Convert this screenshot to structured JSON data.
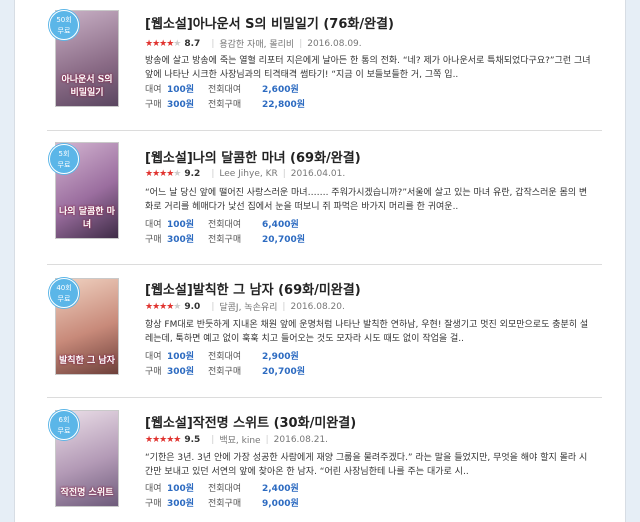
{
  "labels": {
    "rent": "대여",
    "buy": "구매",
    "rent_all": "전회대여",
    "buy_all": "전회구매"
  },
  "items": [
    {
      "badge_count": "50회",
      "badge_free": "무료",
      "cover_text": "아나운서 S의 비밀일기",
      "title": "[웹소설]아나운서 S의 비밀일기 (76화/완결)",
      "stars_filled": 4,
      "rating": "8.7",
      "author": "용감한 자매, 몰리비",
      "date": "2016.08.09.",
      "desc": "방송에 살고 방송에 죽는 열혈 리포터 지은에게 날아든 한 통의 전화. “네? 제가 아나운서로 특채되었다구요?”그런 그녀 앞에 나타난 시크한 사장님과의 티격태격 썸타기! “지금 이 보들보들한 거, 그쪽 입..",
      "rent": "100원",
      "rent_all": "2,600원",
      "buy": "300원",
      "buy_all": "22,800원"
    },
    {
      "badge_count": "5회",
      "badge_free": "무료",
      "cover_text": "나의 달콤한 마녀",
      "title": "[웹소설]나의 달콤한 마녀 (69화/완결)",
      "stars_filled": 4,
      "rating": "9.2",
      "author": "Lee Jihye, KR",
      "date": "2016.04.01.",
      "desc": "“어느 날 당신 앞에 떨어진 사랑스러운 마녀……. 주워가시겠습니까?”서울에 살고 있는 마녀 유란, 갑작스러운 몸의 변화로 거리를 헤매다가 낯선 집에서 눈을 떠보니 쥐 파먹은 바가지 머리를 한 귀여운..",
      "rent": "100원",
      "rent_all": "6,400원",
      "buy": "300원",
      "buy_all": "20,700원"
    },
    {
      "badge_count": "40회",
      "badge_free": "무료",
      "cover_text": "발칙한 그 남자",
      "title": "[웹소설]발칙한 그 남자 (69화/미완결)",
      "stars_filled": 4,
      "rating": "9.0",
      "author": "달콤J, 녹손유리",
      "date": "2016.08.20.",
      "desc": "항상 FM대로 반듯하게 지내온 채원 앞에 운명처럼 나타난 발칙한 연하남, 우현! 잘생기고 멋진 외모만으로도 충분히 설레는데, 툭하면 예고 없이 훅훅 치고 들어오는 것도 모자라 시도 때도 없이 작업을 걸..",
      "rent": "100원",
      "rent_all": "2,900원",
      "buy": "300원",
      "buy_all": "20,700원"
    },
    {
      "badge_count": "6회",
      "badge_free": "무료",
      "cover_text": "작전명 스위트",
      "title": "[웹소설]작전명 스위트 (30화/미완결)",
      "stars_filled": 5,
      "rating": "9.5",
      "author": "백묘, kine",
      "date": "2016.08.21.",
      "desc": "“기한은 3년. 3년 안에 가장 성공한 사람에게 재양 그룹을 물려주겠다.” 라는 말을 들었지만, 무엇을 해야 할지 몰라 시간만 보내고 있던 서연의 앞에 찾아온 한 남자. “어린 사장님한테 나를 주는 대가로 시..",
      "rent": "100원",
      "rent_all": "2,400원",
      "buy": "300원",
      "buy_all": "9,000원"
    }
  ],
  "cover_colors": [
    [
      "#b99ab2",
      "#6f5572"
    ],
    [
      "#c4a3c6",
      "#4d3554"
    ],
    [
      "#e8b9a3",
      "#8b5246"
    ],
    [
      "#d7c3d4",
      "#7b6a86"
    ]
  ],
  "accent": "#2d6bc1",
  "badge_color": "#5bb6e8"
}
